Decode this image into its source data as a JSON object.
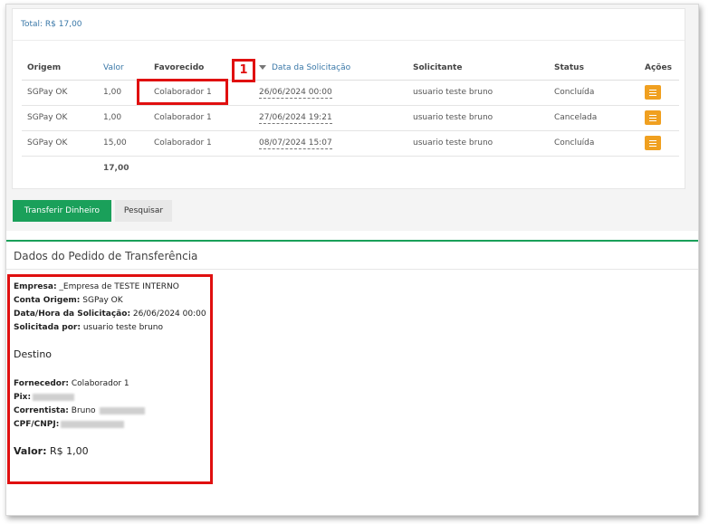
{
  "summary": {
    "total": "Total: R$ 17,00"
  },
  "table": {
    "headers": {
      "origem": "Origem",
      "valor": "Valor",
      "favorecido": "Favorecido",
      "data": "Data da Solicitação",
      "solicitante": "Solicitante",
      "status": "Status",
      "acoes": "Ações"
    },
    "rows": [
      {
        "origem": "SGPay OK",
        "valor": "1,00",
        "favorecido": "Colaborador 1",
        "data": "26/06/2024 00:00",
        "solicitante": "usuario teste bruno",
        "status": "Concluída"
      },
      {
        "origem": "SGPay OK",
        "valor": "1,00",
        "favorecido": "Colaborador 1",
        "data": "27/06/2024 19:21",
        "solicitante": "usuario teste bruno",
        "status": "Cancelada"
      },
      {
        "origem": "SGPay OK",
        "valor": "15,00",
        "favorecido": "Colaborador 1",
        "data": "08/07/2024 15:07",
        "solicitante": "usuario teste bruno",
        "status": "Concluída"
      }
    ],
    "sum": "17,00"
  },
  "buttons": {
    "transfer": "Transferir Dinheiro",
    "search": "Pesquisar"
  },
  "details": {
    "title": "Dados do Pedido de Transferência",
    "empresa_label": "Empresa:",
    "empresa_value": " _Empresa de TESTE INTERNO",
    "conta_label": "Conta Origem:",
    "conta_value": " SGPay OK",
    "data_label": "Data/Hora da Solicitação:",
    "data_value": " 26/06/2024 00:00",
    "solicitada_label": "Solicitada por:",
    "solicitada_value": " usuario teste bruno",
    "destino_title": "Destino",
    "fornecedor_label": "Fornecedor:",
    "fornecedor_value": " Colaborador 1",
    "pix_label": "Pix:",
    "correntista_label": "Correntista:",
    "correntista_value": " Bruno",
    "cpf_label": "CPF/CNPJ:",
    "valor_label": "Valor:",
    "valor_value": " R$ 1,00"
  },
  "annotation": {
    "number": "1"
  },
  "colors": {
    "accent_green": "#1aa05a",
    "link_blue": "#3a78a8",
    "action_orange": "#f0a020",
    "annotation_red": "#e01010"
  }
}
